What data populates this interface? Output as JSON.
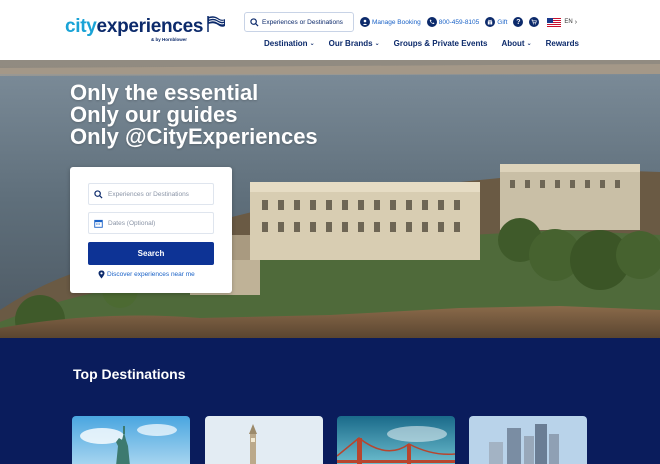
{
  "header": {
    "logo": {
      "city": "city",
      "experiences": "experiences",
      "sub": "& by Hornblower"
    },
    "search_placeholder": "Experiences or Destinations",
    "manage_booking": "Manage Booking",
    "phone": "800-459-8105",
    "gift": "Gift",
    "lang": "EN",
    "nav": [
      {
        "label": "Destination",
        "dropdown": true
      },
      {
        "label": "Our Brands",
        "dropdown": true
      },
      {
        "label": "Groups & Private Events",
        "dropdown": false
      },
      {
        "label": "About",
        "dropdown": true
      },
      {
        "label": "Rewards",
        "dropdown": false
      }
    ]
  },
  "hero": {
    "headline": [
      "Only the essential",
      "Only our guides",
      "Only @CityExperiences"
    ],
    "search_placeholder": "Experiences or Destinations",
    "dates_placeholder": "Dates (Optional)",
    "search_button": "Search",
    "near_me": "Discover experiences near me"
  },
  "destinations": {
    "title": "Top Destinations"
  },
  "colors": {
    "brand_navy": "#0c2a6b",
    "brand_cyan": "#1aa3d6",
    "button_blue": "#0d3395",
    "link_blue": "#1a62c7",
    "section_bg": "#0a1c5c"
  }
}
